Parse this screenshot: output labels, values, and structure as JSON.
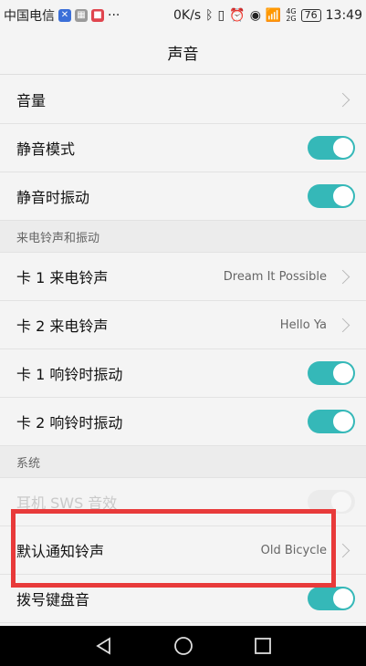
{
  "status_bar": {
    "carrier": "中国电信",
    "net_speed": "0K/s",
    "network": [
      "4G",
      "2G"
    ],
    "battery": "76",
    "time": "13:49",
    "more": "···"
  },
  "title": "声音",
  "rows": {
    "volume": {
      "label": "音量"
    },
    "silent_mode": {
      "label": "静音模式",
      "on": true
    },
    "silent_vibrate": {
      "label": "静音时振动",
      "on": true
    }
  },
  "sections": {
    "ringtone": "来电铃声和振动",
    "system": "系统"
  },
  "ringtone_rows": {
    "sim1_ringtone": {
      "label": "卡 1 来电铃声",
      "value": "Dream It Possible"
    },
    "sim2_ringtone": {
      "label": "卡 2 来电铃声",
      "value": "Hello Ya"
    },
    "sim1_vibrate": {
      "label": "卡 1 响铃时振动",
      "on": true
    },
    "sim2_vibrate": {
      "label": "卡 2 响铃时振动",
      "on": true
    }
  },
  "system_rows": {
    "swc_effect": {
      "label": "耳机 SWS 音效",
      "on": false,
      "disabled": true
    },
    "notification_tone": {
      "label": "默认通知铃声",
      "value": "Old Bicycle"
    },
    "dialpad_tone": {
      "label": "拨号键盘音",
      "on": true
    }
  },
  "colors": {
    "accent": "#35b8b8",
    "highlight": "#e83a3a"
  }
}
